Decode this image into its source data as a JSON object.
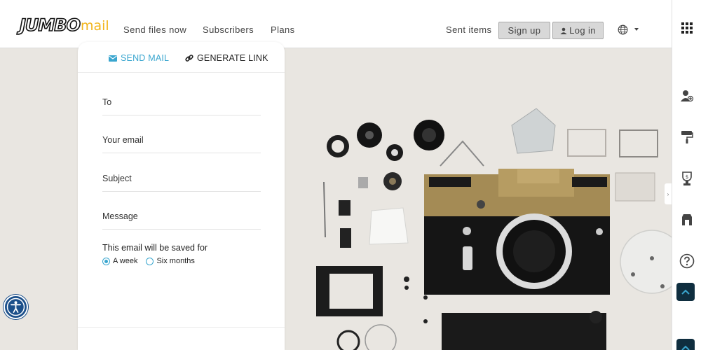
{
  "logo": {
    "brand": "JUMBO",
    "suffix": "mail"
  },
  "nav": {
    "send_files": "Send files now",
    "subscribers": "Subscribers",
    "plans": "Plans",
    "sent_items": "Sent items",
    "sign_up": "Sign up",
    "log_in": "Log in"
  },
  "tabs": {
    "send_mail": "SEND MAIL",
    "generate_link": "GENERATE LINK"
  },
  "form": {
    "to": "To",
    "your_email": "Your email",
    "subject": "Subject",
    "message": "Message",
    "save_label": "This email will be saved for",
    "options": [
      {
        "label": "A week",
        "selected": true
      },
      {
        "label": "Six months",
        "selected": false
      }
    ]
  },
  "sidebar": {
    "icons": [
      "grid-icon",
      "add-user-icon",
      "paint-roller-icon",
      "trophy-icon",
      "store-icon",
      "help-icon",
      "scroll-up-icon",
      "scroll-up-icon"
    ]
  },
  "colors": {
    "accent": "#3aa6cf",
    "logo_yellow": "#f2b51b",
    "a11y_blue": "#1b4f8a",
    "dark_button": "#0f2e3f"
  }
}
